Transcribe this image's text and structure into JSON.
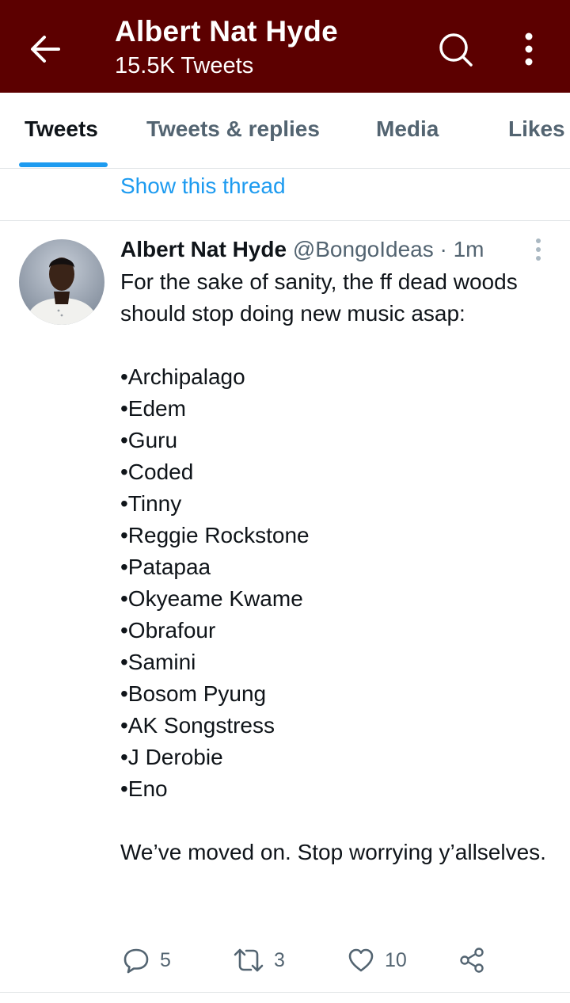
{
  "header": {
    "title": "Albert Nat Hyde",
    "subtitle": "15.5K Tweets",
    "bg_color": "#5c0000",
    "icons": [
      "back-arrow-icon",
      "search-icon",
      "more-vertical-icon"
    ]
  },
  "tabs": [
    {
      "label": "Tweets",
      "active": true
    },
    {
      "label": "Tweets & replies",
      "active": false
    },
    {
      "label": "Media",
      "active": false
    },
    {
      "label": "Likes",
      "active": false
    }
  ],
  "thread_link": "Show this thread",
  "tweet": {
    "author_name": "Albert Nat Hyde",
    "handle": "@BongoIdeas",
    "separator": "·",
    "time": "1m",
    "intro": "For the sake of sanity, the ff dead woods should stop doing new music asap:",
    "list": [
      "•Archipalago",
      "•Edem",
      "•Guru",
      "•Coded",
      "•Tinny",
      "•Reggie Rockstone",
      "•Patapaa",
      "•Okyeame Kwame",
      "•Obrafour",
      "•Samini",
      "•Bosom Pyung",
      "•AK Songstress",
      "•J Derobie",
      "•Eno"
    ],
    "outro": "We’ve moved on. Stop worrying y’allselves.",
    "stats": {
      "replies": "5",
      "retweets": "3",
      "likes": "10"
    }
  },
  "colors": {
    "accent": "#1d9bf0",
    "secondary_text": "#536471",
    "divider": "#e1e4e6"
  }
}
